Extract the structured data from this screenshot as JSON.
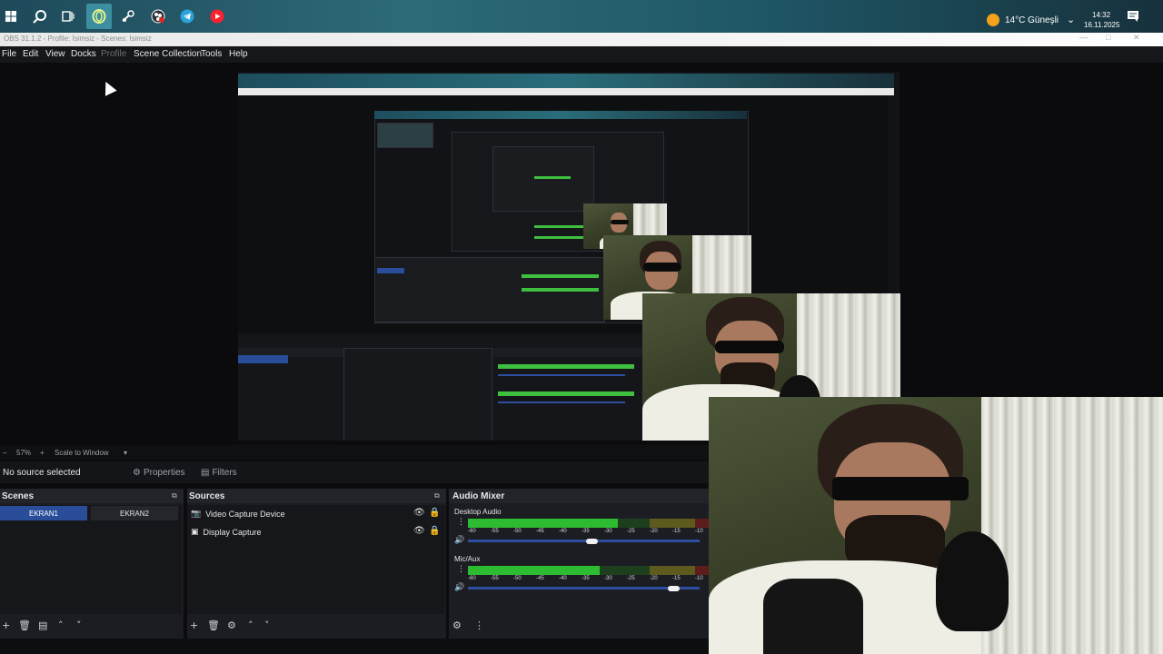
{
  "taskbar": {
    "icons": [
      "windows-start-icon",
      "search-icon",
      "task-view-icon",
      "opera-gx-icon",
      "steam-icon",
      "obs-icon",
      "telegram-icon",
      "youtube-music-icon"
    ],
    "weather": "14°C  Güneşli",
    "time": "14:32",
    "date": "16.11.2025"
  },
  "window": {
    "title": "OBS 31.1.2 - Profile: İsimsiz - Scenes: İsimsiz"
  },
  "menu": {
    "file": "File",
    "edit": "Edit",
    "view": "View",
    "docks": "Docks",
    "profile": "Profile",
    "scene_collection": "Scene Collection",
    "tools": "Tools",
    "help": "Help"
  },
  "preview": {
    "zoom": "57%",
    "scale_mode": "Scale to Window"
  },
  "properties_bar": {
    "no_source": "No source selected",
    "properties": "Properties",
    "filters": "Filters"
  },
  "scenes": {
    "title": "Scenes",
    "items": [
      {
        "label": "EKRAN1",
        "selected": true
      },
      {
        "label": "EKRAN2",
        "selected": false
      }
    ]
  },
  "sources": {
    "title": "Sources",
    "items": [
      {
        "label": "Video Capture Device",
        "icon": "camera-icon"
      },
      {
        "label": "Display Capture",
        "icon": "monitor-icon"
      }
    ]
  },
  "mixer": {
    "title": "Audio Mixer",
    "channels": [
      {
        "name": "Desktop Audio",
        "level": 0.62,
        "volume": 0.53
      },
      {
        "name": "Mic/Aux",
        "level": 0.55,
        "volume": 0.88
      }
    ],
    "scale_labels": [
      "-60",
      "-55",
      "-50",
      "-45",
      "-40",
      "-35",
      "-30",
      "-25",
      "-20",
      "-15",
      "-10"
    ]
  },
  "colors": {
    "accent": "#2a4d9a",
    "meter_green": "#2dbb32",
    "taskbar": "#1e4a5a"
  }
}
